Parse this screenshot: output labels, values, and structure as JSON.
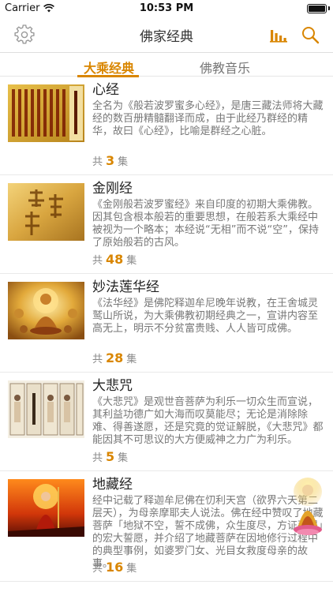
{
  "status": {
    "carrier": "Carrier",
    "time": "10:53 PM",
    "battery_level": 1.0
  },
  "nav": {
    "title": "佛家经典",
    "settings_icon": "gear-icon",
    "stats_icon": "bar-chart-icon",
    "search_icon": "search-icon",
    "accent_color": "#d98600"
  },
  "tabs": [
    {
      "label": "大乘经典",
      "active": true
    },
    {
      "label": "佛教音乐",
      "active": false
    }
  ],
  "items": [
    {
      "title": "心经",
      "description": "全名为《般若波罗蜜多心经》，是唐三藏法师将大藏经的数百册精髓翻译而成，由于此经乃群经的精华，故曰《心经》，比喻是群经之心脏。",
      "count_prefix": "共",
      "count": "3",
      "count_suffix": "集"
    },
    {
      "title": "金刚经",
      "description": "《金刚般若波罗蜜经》来自印度的初期大乘佛教。因其包含根本般若的重要思想，在般若系大乘经中被视为一个略本；本经说“无相”而不说“空”，保持了原始般若的古风。",
      "count_prefix": "共",
      "count": "48",
      "count_suffix": "集"
    },
    {
      "title": "妙法莲华经",
      "description": "《法华经》是佛陀释迦牟尼晚年说教，在王舍城灵鹫山所说，为大乘佛教初期经典之一，宣讲内容至高无上，明示不分贫富贵贱、人人皆可成佛。",
      "count_prefix": "共",
      "count": "28",
      "count_suffix": "集"
    },
    {
      "title": "大悲咒",
      "description": "《大悲咒》是观世音菩萨为利乐一切众生而宣说，其利益功德广如大海而叹莫能尽；无论是消除除难、得善遂愿，还是究竟的觉证解脱，《大悲咒》都能因其不可思议的大方便威神之力广为利乐。",
      "count_prefix": "共",
      "count": "5",
      "count_suffix": "集"
    },
    {
      "title": "地藏经",
      "description": "经中记载了释迦牟尼佛在忉利天宫（欲界六天第二层天），为母亲摩耶夫人说法。佛在经中赞叹了地藏菩萨「地狱不空，誓不成佛，众生度尽，方证菩提」的宏大誓愿，并介绍了地藏菩萨在因地修行过程中的典型事例，如婆罗门女、光目女救度母亲的故事。",
      "count_prefix": "共",
      "count": "16",
      "count_suffix": "集"
    }
  ]
}
